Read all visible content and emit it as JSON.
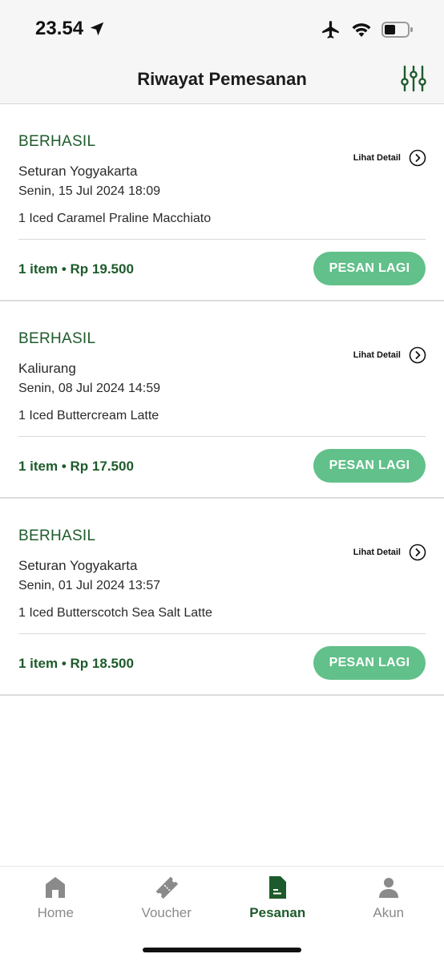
{
  "status_bar": {
    "time": "23.54"
  },
  "header": {
    "title": "Riwayat Pemesanan",
    "filter_icon": "sliders-icon"
  },
  "orders": [
    {
      "status": "BERHASIL",
      "store": "Seturan Yogyakarta",
      "datetime": "Senin, 15 Jul 2024  18:09",
      "items": "1 Iced Caramel Praline Macchiato",
      "summary": "1 item • Rp 19.500",
      "detail_label": "Lihat Detail",
      "reorder_label": "PESAN LAGI"
    },
    {
      "status": "BERHASIL",
      "store": "Kaliurang",
      "datetime": "Senin, 08 Jul 2024  14:59",
      "items": "1 Iced Buttercream Latte",
      "summary": "1 item • Rp 17.500",
      "detail_label": "Lihat Detail",
      "reorder_label": "PESAN LAGI"
    },
    {
      "status": "BERHASIL",
      "store": "Seturan Yogyakarta",
      "datetime": "Senin, 01 Jul 2024  13:57",
      "items": "1 Iced Butterscotch Sea Salt Latte",
      "summary": "1 item • Rp 18.500",
      "detail_label": "Lihat Detail",
      "reorder_label": "PESAN LAGI"
    }
  ],
  "nav": {
    "items": [
      {
        "label": "Home",
        "icon": "home-icon"
      },
      {
        "label": "Voucher",
        "icon": "ticket-icon"
      },
      {
        "label": "Pesanan",
        "icon": "document-icon",
        "active": true
      },
      {
        "label": "Akun",
        "icon": "person-icon"
      }
    ]
  },
  "colors": {
    "brand_green": "#1e5b2c",
    "button_green": "#62c08a",
    "inactive_grey": "#8a8a8a"
  }
}
